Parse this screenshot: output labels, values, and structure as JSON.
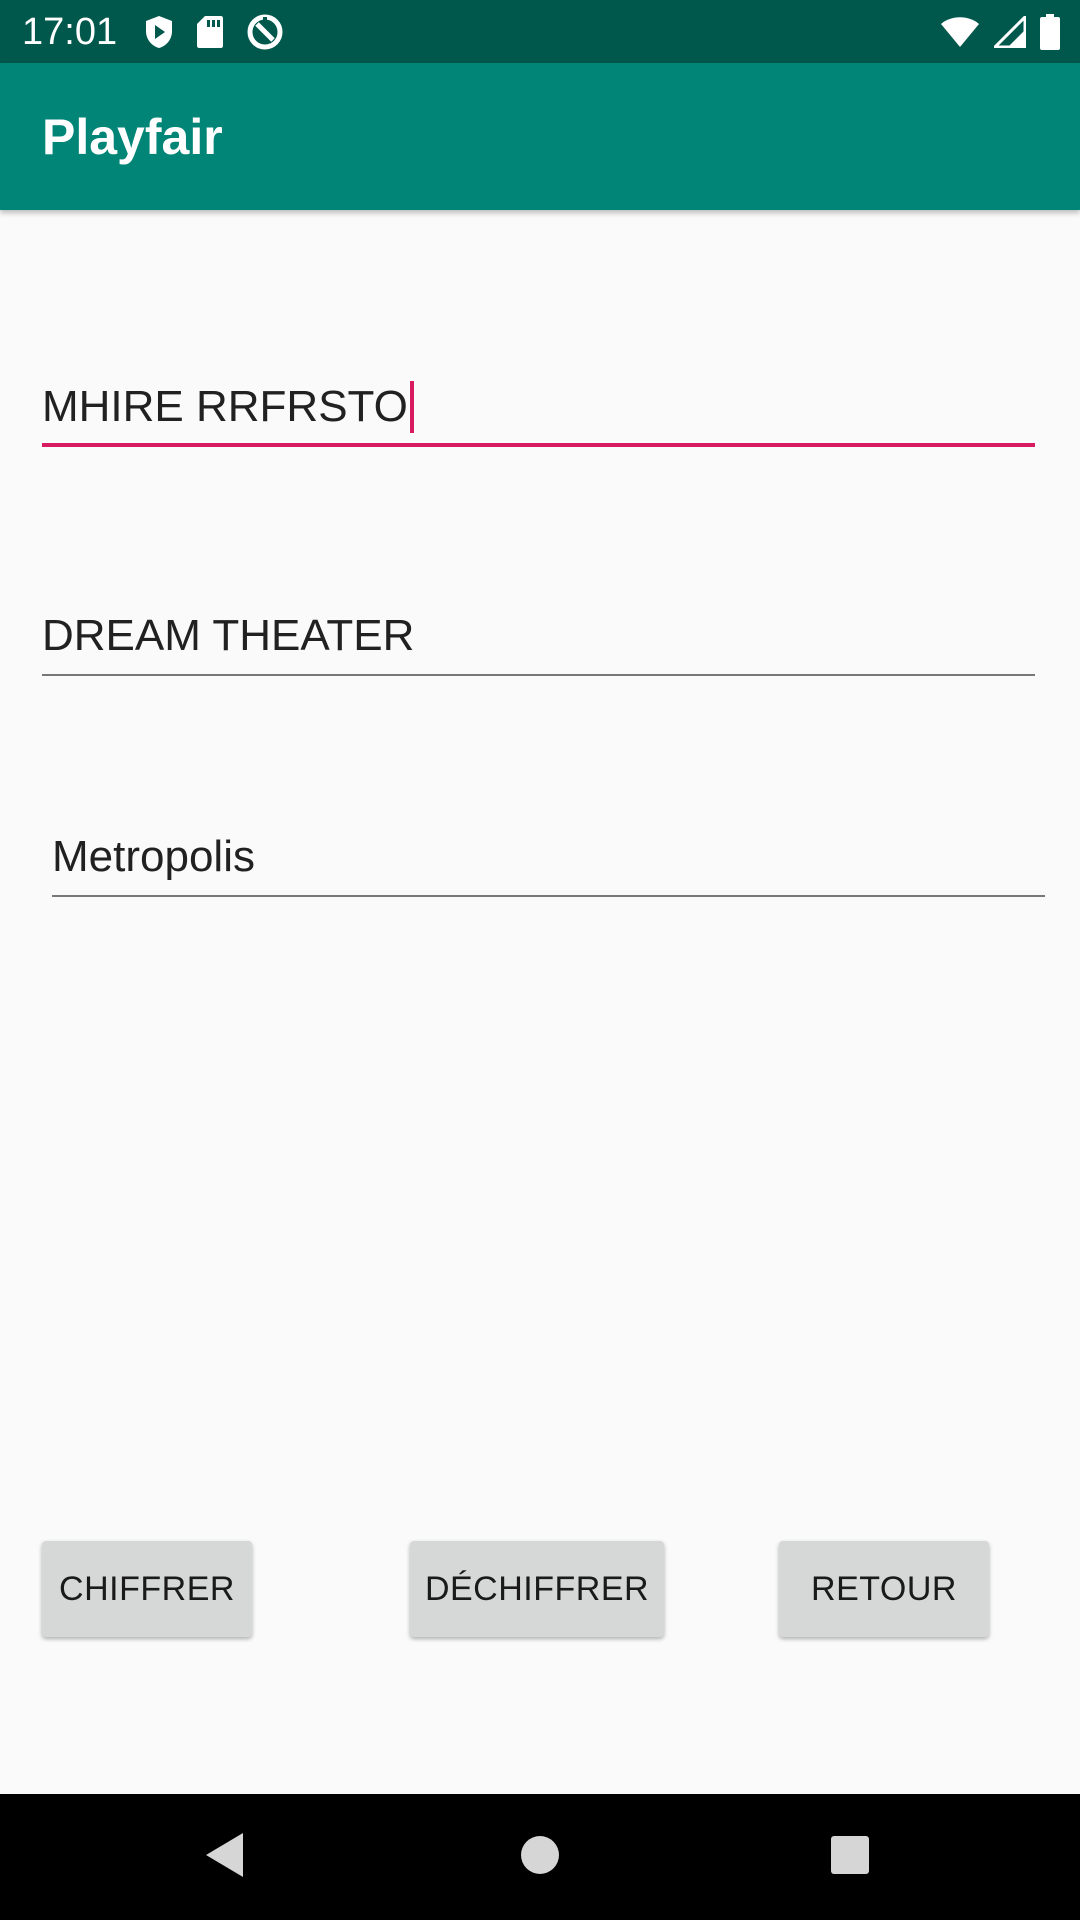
{
  "status_bar": {
    "time": "17:01",
    "left_icons": [
      "play-protect-icon",
      "sd-card-icon",
      "data-saver-icon"
    ],
    "right_icons": [
      "wifi-icon",
      "cell-signal-icon",
      "battery-icon"
    ]
  },
  "app_bar": {
    "title": "Playfair"
  },
  "fields": {
    "result_value": "MHIRE RRFRSTO",
    "key_value": "DREAM THEATER",
    "message_value": "Metropolis"
  },
  "buttons": {
    "encrypt_label": "CHIFFRER",
    "decrypt_label": "DÉCHIFFRER",
    "back_label": "RETOUR"
  },
  "nav_bar": {
    "icons": [
      "back-triangle-icon",
      "home-circle-icon",
      "recents-square-icon"
    ]
  },
  "colors": {
    "status_bar": "#00574b",
    "app_bar": "#008577",
    "accent": "#d81b60",
    "background": "#fafafa",
    "button": "#d6d7d7"
  }
}
